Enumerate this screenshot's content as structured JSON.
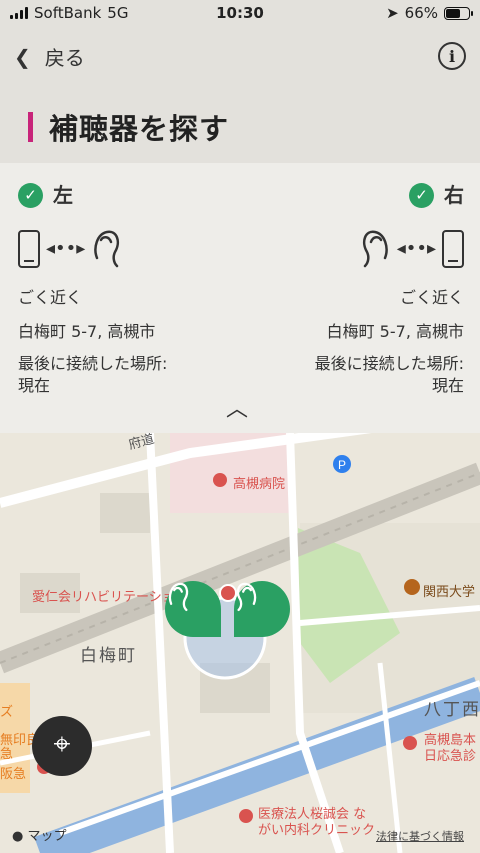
{
  "status_bar": {
    "carrier": "SoftBank",
    "network": "5G",
    "time": "10:30",
    "battery": "66%"
  },
  "nav": {
    "back_label": "戻る",
    "title": "補聴器を探す"
  },
  "left": {
    "label": "左",
    "distance": "ごく近く",
    "address": "白梅町 5-7, 高槻市",
    "last_location_label": "最後に接続した場所:",
    "last_location_value": "現在"
  },
  "right": {
    "label": "右",
    "distance": "ごく近く",
    "address": "白梅町 5-7, 高槻市",
    "last_location_label": "最後に接続した場所:",
    "last_location_value": "現在"
  },
  "map": {
    "labels": {
      "road": "府道",
      "hospital": "高槻病院",
      "rehab": "愛仁会リハビリテーショ",
      "area": "白梅町",
      "univ": "関西大学",
      "hatchome": "八丁西",
      "takatsuki_main": "高槻島本",
      "nikko": "日応急診",
      "clinic1": "医療法人桜誠会 な",
      "clinic2": "がい内科クリニック",
      "z": "ズ",
      "mujirushi": "無印良",
      "kyu": "急",
      "hankyu": "阪急"
    },
    "attribution": "マップ",
    "legal": "法律に基づく情報"
  },
  "colors": {
    "accent": "#c8247a",
    "green": "#2aa063"
  },
  "icons": {
    "locate": "crosshair-icon",
    "info": "info-icon",
    "back": "chevron-left-icon",
    "collapse": "chevron-up-icon"
  }
}
